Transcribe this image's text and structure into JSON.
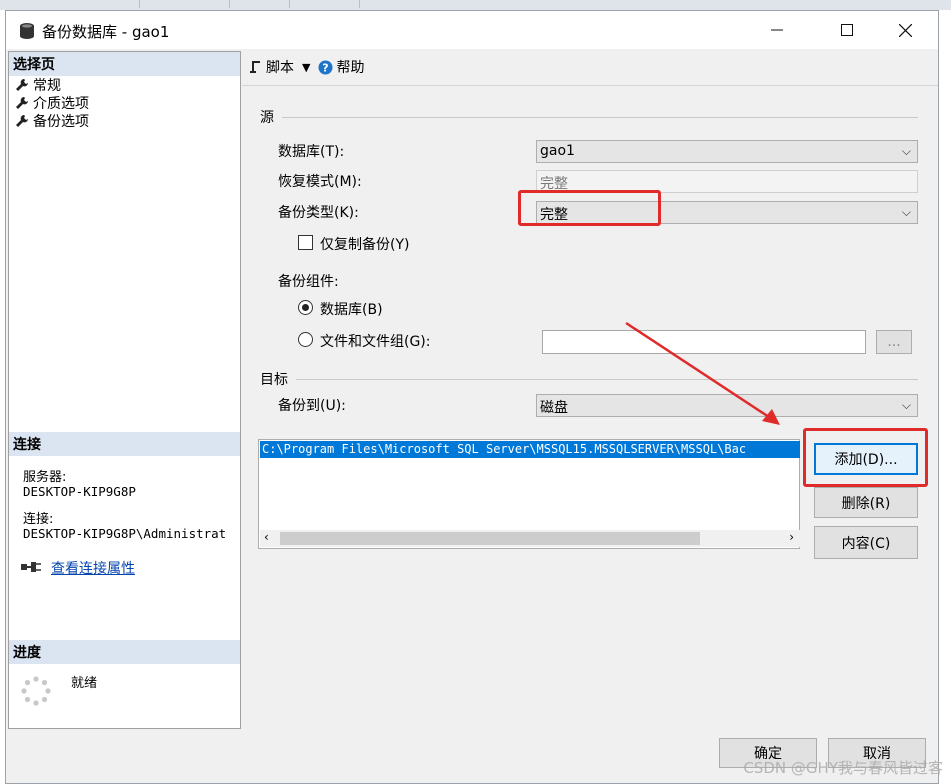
{
  "window": {
    "title": "备份数据库 - gao1"
  },
  "left": {
    "select_page_header": "选择页",
    "nav": [
      "常规",
      "介质选项",
      "备份选项"
    ],
    "connection_header": "连接",
    "server_label": "服务器:",
    "server_value": "DESKTOP-KIP9G8P",
    "connection_label": "连接:",
    "connection_value": "DESKTOP-KIP9G8P\\Administrat",
    "view_link": "查看连接属性",
    "progress_header": "进度",
    "progress_status": "就绪"
  },
  "toolbar": {
    "script": "脚本",
    "help": "帮助"
  },
  "source": {
    "group": "源",
    "database_label": "数据库(T):",
    "database_value": "gao1",
    "recovery_label": "恢复模式(M):",
    "recovery_value": "完整",
    "backup_type_label": "备份类型(K):",
    "backup_type_value": "完整",
    "copy_only_label": "仅复制备份(Y)",
    "component_label": "备份组件:",
    "radio_database": "数据库(B)",
    "radio_files": "文件和文件组(G):",
    "browse": "..."
  },
  "target": {
    "group": "目标",
    "backup_to_label": "备份到(U):",
    "backup_to_value": "磁盘",
    "path": "C:\\Program Files\\Microsoft SQL Server\\MSSQL15.MSSQLSERVER\\MSSQL\\Bac",
    "add": "添加(D)...",
    "remove": "删除(R)",
    "contents": "内容(C)"
  },
  "footer": {
    "ok": "确定",
    "cancel": "取消"
  },
  "watermark": "CSDN @GHY我与春风皆过客",
  "colors": {
    "highlight": "#e02b2b",
    "selection": "#0078d7",
    "header_bg": "#dbe4f1"
  }
}
